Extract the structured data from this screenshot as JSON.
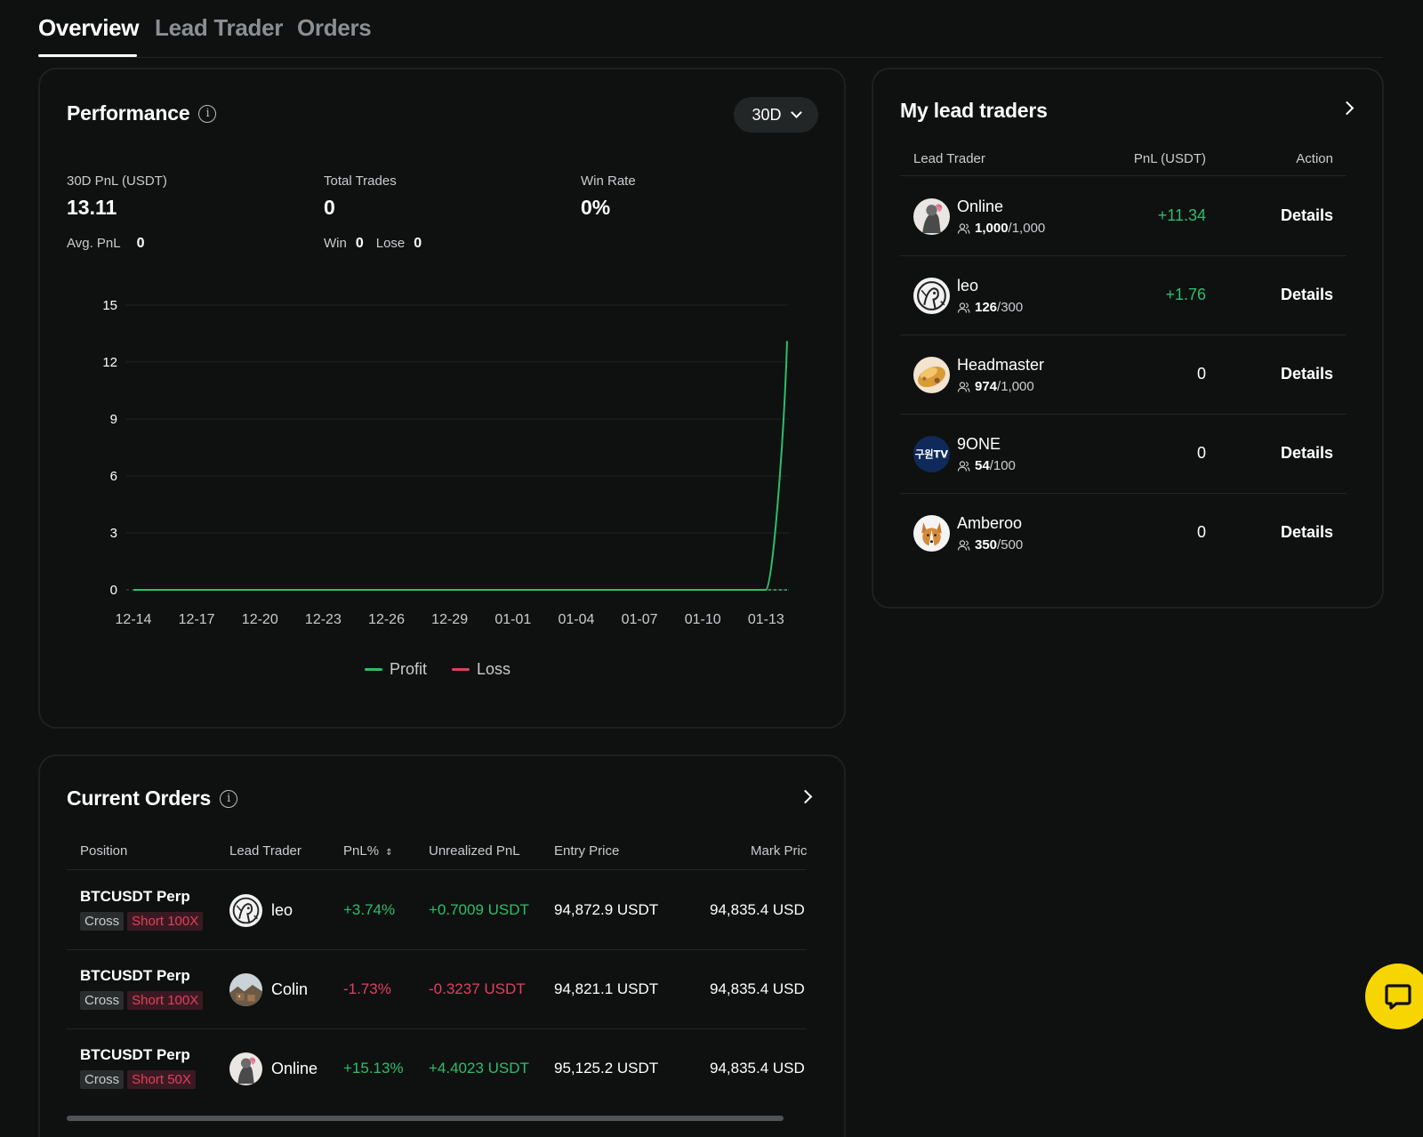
{
  "tabs": [
    {
      "label": "Overview",
      "active": true
    },
    {
      "label": "Lead Trader",
      "active": false
    },
    {
      "label": "Orders",
      "active": false
    }
  ],
  "performance": {
    "title": "Performance",
    "range": "30D",
    "pnl_label": "30D PnL (USDT)",
    "pnl_value": "13.11",
    "trades_label": "Total Trades",
    "trades_value": "0",
    "winrate_label": "Win Rate",
    "winrate_value": "0%",
    "avg_pnl_label": "Avg. PnL",
    "avg_pnl_value": "0",
    "win_label": "Win",
    "win_value": "0",
    "lose_label": "Lose",
    "lose_value": "0"
  },
  "chart_data": {
    "type": "line",
    "x": [
      "12-14",
      "12-15",
      "12-16",
      "12-17",
      "12-18",
      "12-19",
      "12-20",
      "12-21",
      "12-22",
      "12-23",
      "12-24",
      "12-25",
      "12-26",
      "12-27",
      "12-28",
      "12-29",
      "12-30",
      "12-31",
      "01-01",
      "01-02",
      "01-03",
      "01-04",
      "01-05",
      "01-06",
      "01-07",
      "01-08",
      "01-09",
      "01-10",
      "01-11",
      "01-12",
      "01-13",
      "01-14"
    ],
    "x_ticks": [
      "12-14",
      "12-17",
      "12-20",
      "12-23",
      "12-26",
      "12-29",
      "01-01",
      "01-04",
      "01-07",
      "01-10",
      "01-13"
    ],
    "y_ticks": [
      0,
      3,
      6,
      9,
      12,
      15
    ],
    "ylim": [
      0,
      15
    ],
    "series": [
      {
        "name": "Profit",
        "color": "#2ebd6a",
        "values": [
          0,
          0,
          0,
          0,
          0,
          0,
          0,
          0,
          0,
          0,
          0,
          0,
          0,
          0,
          0,
          0,
          0,
          0,
          0,
          0,
          0,
          0,
          0,
          0,
          0,
          0,
          0,
          0,
          0,
          0,
          0,
          13.11
        ]
      },
      {
        "name": "Loss",
        "color": "#e0405e",
        "values": [
          0,
          0,
          0,
          0,
          0,
          0,
          0,
          0,
          0,
          0,
          0,
          0,
          0,
          0,
          0,
          0,
          0,
          0,
          0,
          0,
          0,
          0,
          0,
          0,
          0,
          0,
          0,
          0,
          0,
          0,
          0,
          0
        ]
      }
    ],
    "grid": true,
    "legend": "bottom-center"
  },
  "lead_traders": {
    "title": "My lead traders",
    "columns": [
      "Lead Trader",
      "PnL (USDT)",
      "Action"
    ],
    "rows": [
      {
        "name": "Online",
        "count": "1,000",
        "total": "/1,000",
        "pnl": "+11.34",
        "pnl_type": "pos",
        "action": "Details",
        "avatar": "sketch-pink"
      },
      {
        "name": "leo",
        "count": "126",
        "total": "/300",
        "pnl": "+1.76",
        "pnl_type": "pos",
        "action": "Details",
        "avatar": "sketch-bw"
      },
      {
        "name": "Headmaster",
        "count": "974",
        "total": "/1,000",
        "pnl": "0",
        "pnl_type": "zero",
        "action": "Details",
        "avatar": "food"
      },
      {
        "name": "9ONE",
        "count": "54",
        "total": "/100",
        "pnl": "0",
        "pnl_type": "zero",
        "action": "Details",
        "avatar": "tv-logo"
      },
      {
        "name": "Amberoo",
        "count": "350",
        "total": "/500",
        "pnl": "0",
        "pnl_type": "zero",
        "action": "Details",
        "avatar": "corgi"
      }
    ],
    "avatar_tv_text": "구원TV"
  },
  "current_orders": {
    "title": "Current Orders",
    "columns": [
      "Position",
      "Lead Trader",
      "PnL%",
      "Unrealized PnL",
      "Entry Price",
      "Mark Pric"
    ],
    "rows": [
      {
        "position": "BTCUSDT Perp",
        "margin": "Cross",
        "side": "Short 100X",
        "trader": "leo",
        "pnl_pct": "+3.74%",
        "unrealized": "+0.7009 USDT",
        "type": "pos",
        "entry": "94,872.9 USDT",
        "mark": "94,835.4 USD",
        "avatar": "sketch-bw"
      },
      {
        "position": "BTCUSDT Perp",
        "margin": "Cross",
        "side": "Short 100X",
        "trader": "Colin",
        "pnl_pct": "-1.73%",
        "unrealized": "-0.3237 USDT",
        "type": "neg",
        "entry": "94,821.1 USDT",
        "mark": "94,835.4 USD",
        "avatar": "landscape"
      },
      {
        "position": "BTCUSDT Perp",
        "margin": "Cross",
        "side": "Short 50X",
        "trader": "Online",
        "pnl_pct": "+15.13%",
        "unrealized": "+4.4023 USDT",
        "type": "pos",
        "entry": "95,125.2 USDT",
        "mark": "94,835.4 USD",
        "avatar": "sketch-pink"
      }
    ]
  },
  "colors": {
    "profit": "#2ebd6a",
    "loss": "#e0405e",
    "chat": "#f7d500"
  }
}
